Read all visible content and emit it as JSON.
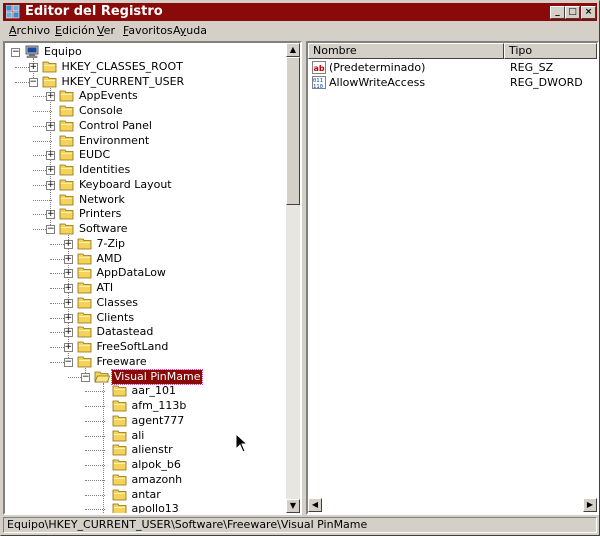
{
  "window": {
    "title": "Editor del Registro"
  },
  "menu": [
    {
      "label": "Archivo",
      "accel": "A"
    },
    {
      "label": "Edición",
      "accel": "E"
    },
    {
      "label": "Ver",
      "accel": "V"
    },
    {
      "label": "Favoritos",
      "accel": "F"
    },
    {
      "label": "Ayuda",
      "accel": "y"
    }
  ],
  "tree": {
    "nodes": [
      {
        "label": "Equipo",
        "level": 0,
        "expander": "-",
        "icon": "computer-icon"
      },
      {
        "label": "HKEY_CLASSES_ROOT",
        "level": 1,
        "expander": "+",
        "icon": "folder-icon"
      },
      {
        "label": "HKEY_CURRENT_USER",
        "level": 1,
        "expander": "-",
        "icon": "folder-icon"
      },
      {
        "label": "AppEvents",
        "level": 2,
        "expander": "+",
        "icon": "folder-icon"
      },
      {
        "label": "Console",
        "level": 2,
        "expander": "",
        "icon": "folder-icon"
      },
      {
        "label": "Control Panel",
        "level": 2,
        "expander": "+",
        "icon": "folder-icon"
      },
      {
        "label": "Environment",
        "level": 2,
        "expander": "",
        "icon": "folder-icon"
      },
      {
        "label": "EUDC",
        "level": 2,
        "expander": "+",
        "icon": "folder-icon"
      },
      {
        "label": "Identities",
        "level": 2,
        "expander": "+",
        "icon": "folder-icon"
      },
      {
        "label": "Keyboard Layout",
        "level": 2,
        "expander": "+",
        "icon": "folder-icon"
      },
      {
        "label": "Network",
        "level": 2,
        "expander": "",
        "icon": "folder-icon"
      },
      {
        "label": "Printers",
        "level": 2,
        "expander": "+",
        "icon": "folder-icon"
      },
      {
        "label": "Software",
        "level": 2,
        "expander": "-",
        "icon": "folder-icon"
      },
      {
        "label": "7-Zip",
        "level": 3,
        "expander": "+",
        "icon": "folder-icon"
      },
      {
        "label": "AMD",
        "level": 3,
        "expander": "+",
        "icon": "folder-icon"
      },
      {
        "label": "AppDataLow",
        "level": 3,
        "expander": "+",
        "icon": "folder-icon"
      },
      {
        "label": "ATI",
        "level": 3,
        "expander": "+",
        "icon": "folder-icon"
      },
      {
        "label": "Classes",
        "level": 3,
        "expander": "+",
        "icon": "folder-icon"
      },
      {
        "label": "Clients",
        "level": 3,
        "expander": "+",
        "icon": "folder-icon"
      },
      {
        "label": "Datastead",
        "level": 3,
        "expander": "+",
        "icon": "folder-icon"
      },
      {
        "label": "FreeSoftLand",
        "level": 3,
        "expander": "+",
        "icon": "folder-icon"
      },
      {
        "label": "Freeware",
        "level": 3,
        "expander": "-",
        "icon": "folder-icon"
      },
      {
        "label": "Visual PinMame",
        "level": 4,
        "expander": "-",
        "icon": "folder-open-icon",
        "selected": true
      },
      {
        "label": "aar_101",
        "level": 5,
        "expander": "",
        "icon": "folder-icon"
      },
      {
        "label": "afm_113b",
        "level": 5,
        "expander": "",
        "icon": "folder-icon"
      },
      {
        "label": "agent777",
        "level": 5,
        "expander": "",
        "icon": "folder-icon"
      },
      {
        "label": "ali",
        "level": 5,
        "expander": "",
        "icon": "folder-icon"
      },
      {
        "label": "alienstr",
        "level": 5,
        "expander": "",
        "icon": "folder-icon"
      },
      {
        "label": "alpok_b6",
        "level": 5,
        "expander": "",
        "icon": "folder-icon"
      },
      {
        "label": "amazonh",
        "level": 5,
        "expander": "",
        "icon": "folder-icon"
      },
      {
        "label": "antar",
        "level": 5,
        "expander": "",
        "icon": "folder-icon"
      },
      {
        "label": "apollo13",
        "level": 5,
        "expander": "",
        "icon": "folder-icon"
      }
    ]
  },
  "list": {
    "columns": [
      "Nombre",
      "Tipo"
    ],
    "rows": [
      {
        "name": "(Predeterminado)",
        "type": "REG_SZ",
        "icon": "string-value-icon"
      },
      {
        "name": "AllowWriteAccess",
        "type": "REG_DWORD",
        "icon": "binary-value-icon"
      }
    ]
  },
  "status": {
    "path": "Equipo\\HKEY_CURRENT_USER\\Software\\Freeware\\Visual PinMame"
  },
  "colors": {
    "titlebar": "#8a0a0a",
    "selection": "#8a0a0a",
    "folder": "#f5d35a",
    "chrome": "#d4d0c8"
  }
}
